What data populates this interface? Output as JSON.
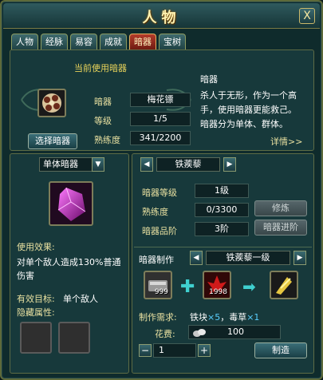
{
  "window": {
    "title": "人物",
    "close": "X"
  },
  "tabs": [
    {
      "label": "人物",
      "active": false
    },
    {
      "label": "经脉",
      "active": false
    },
    {
      "label": "易容",
      "active": false
    },
    {
      "label": "成就",
      "active": false
    },
    {
      "label": "暗器",
      "active": true
    },
    {
      "label": "宝树",
      "active": false
    }
  ],
  "current": {
    "heading": "当前使用暗器",
    "rows": [
      {
        "label": "暗器",
        "value": "梅花镖"
      },
      {
        "label": "等级",
        "value": "1/5"
      },
      {
        "label": "熟练度",
        "value": "341/2200"
      }
    ],
    "select_button": "选择暗器",
    "info_title": "暗器",
    "info_lines": [
      "杀人于无形，作为一个高",
      "手，使用暗器更能救己。",
      "暗器分为单体、群体。"
    ],
    "details_link": "详情>>"
  },
  "left": {
    "type_dropdown": "单体暗器",
    "effect_label": "使用效果:",
    "effect_lines": [
      "对单个敌人造成130%普通",
      "伤害"
    ],
    "target_label": "有效目标:",
    "target_value": "单个敌人",
    "hidden_attr_label": "隐藏属性:"
  },
  "right": {
    "weapon_name": "铁蒺藜",
    "stats": [
      {
        "label": "暗器等级",
        "value": "1级"
      },
      {
        "label": "熟练度",
        "value": "0/3300"
      },
      {
        "label": "暗器品阶",
        "value": "3阶"
      }
    ],
    "practice_button": "修炼",
    "advance_button": "暗器进阶",
    "craft_label": "暗器制作",
    "craft_recipe": "铁蒺藜一级",
    "material1_count": "999",
    "material2_count": "1998",
    "need_label": "制作需求:",
    "need_item1": "铁块",
    "need_item1_qty": "×5",
    "need_sep": "，",
    "need_item2": "毒草",
    "need_item2_qty": "×1",
    "cost_label": "花费:",
    "cost_value": "100",
    "quantity": "1",
    "make_button": "制造"
  },
  "colors": {
    "accent": "#e8d35a",
    "active_tab": "#b33b2a",
    "panel": "#17393b"
  }
}
